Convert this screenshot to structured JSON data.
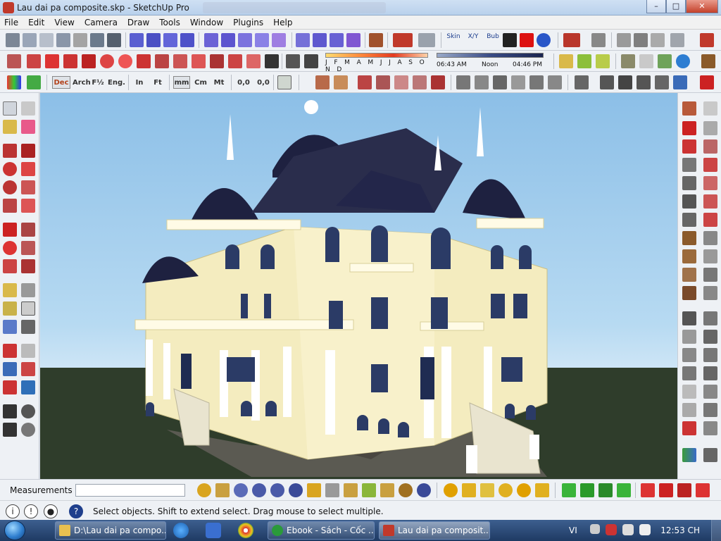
{
  "window": {
    "title": "Lau dai pa composite.skp - SketchUp Pro",
    "minimize": "–",
    "maximize": "□",
    "close": "✕"
  },
  "menu": [
    "File",
    "Edit",
    "View",
    "Camera",
    "Draw",
    "Tools",
    "Window",
    "Plugins",
    "Help"
  ],
  "toolbar_labels": {
    "skin": "Skin",
    "xy": "X/Y",
    "bub": "Bub"
  },
  "shadow": {
    "months": "J F M A M J J A S O N D",
    "time_start": "06:43 AM",
    "time_mid": "Noon",
    "time_end": "04:46 PM"
  },
  "units": {
    "dec": "Dec",
    "arch": "Arch",
    "frac": "F½",
    "eng": "Eng.",
    "in": "In",
    "ft": "Ft",
    "mm": "mm",
    "cm": "Cm",
    "mt": "Mt",
    "p1": "0,0",
    "p2": "0,0"
  },
  "measurements": {
    "label": "Measurements",
    "value": ""
  },
  "status": {
    "message": "Select objects. Shift to extend select. Drag mouse to select multiple."
  },
  "taskbar": {
    "tasks": [
      "D:\\Lau dai pa compo...",
      "Ebook - Sách - Cốc ...",
      "Lau dai pa composit..."
    ],
    "lang": "VI",
    "clock": "12:53 CH"
  },
  "colors": {
    "accent_red": "#c0392b",
    "building": "#f4ecbf",
    "roof": "#1e2140",
    "sky": "#8cbfe7",
    "ground": "#2f3d2b"
  }
}
